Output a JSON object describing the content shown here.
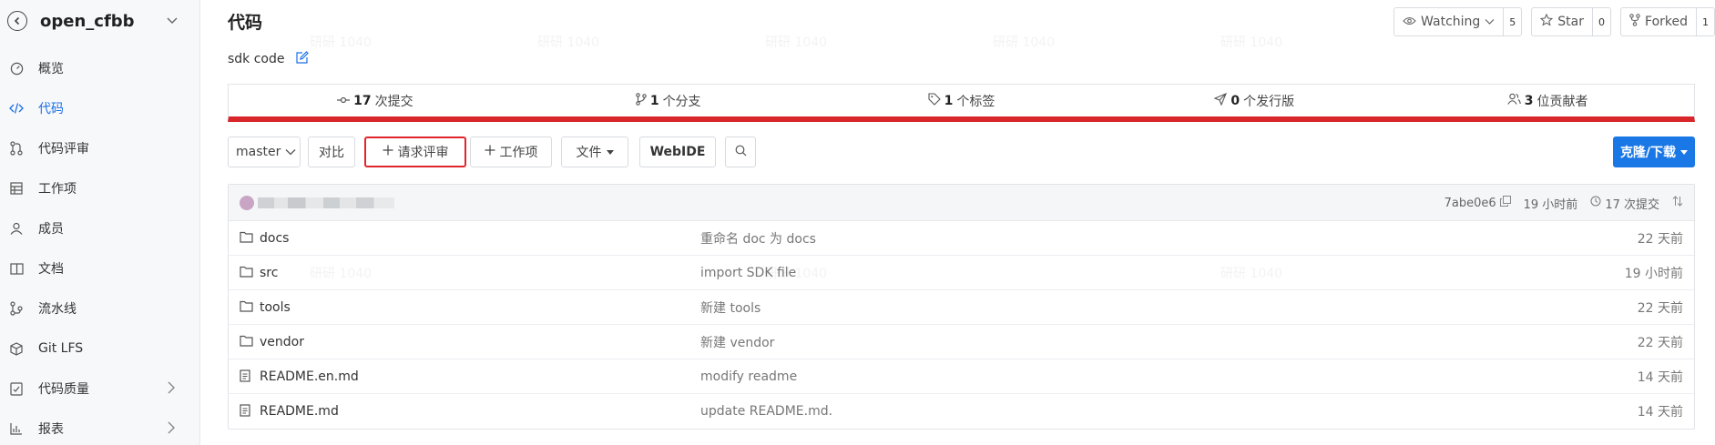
{
  "project": {
    "name": "open_cfbb"
  },
  "sidebar": {
    "items": [
      {
        "label": "概览",
        "icon": "gauge-icon"
      },
      {
        "label": "代码",
        "icon": "code-icon",
        "active": true
      },
      {
        "label": "代码评审",
        "icon": "merge-request-icon"
      },
      {
        "label": "工作项",
        "icon": "table-icon"
      },
      {
        "label": "成员",
        "icon": "user-icon"
      },
      {
        "label": "文档",
        "icon": "book-icon"
      },
      {
        "label": "流水线",
        "icon": "pipeline-icon"
      },
      {
        "label": "Git LFS",
        "icon": "cube-icon"
      },
      {
        "label": "代码质量",
        "icon": "shield-check-icon",
        "expandable": true
      },
      {
        "label": "报表",
        "icon": "bar-chart-icon",
        "expandable": true
      }
    ]
  },
  "header": {
    "title": "代码",
    "description": "sdk code",
    "watch_label": "Watching",
    "watch_count": "5",
    "star_label": "Star",
    "star_count": "0",
    "fork_label": "Forked",
    "fork_count": "1"
  },
  "stats": {
    "commits_num": "17",
    "commits_label": "次提交",
    "branches_num": "1",
    "branches_label": "个分支",
    "tags_num": "1",
    "tags_label": "个标签",
    "releases_num": "0",
    "releases_label": "个发行版",
    "contributors_num": "3",
    "contributors_label": "位贡献者",
    "accent_color": "#d8262b"
  },
  "toolbar": {
    "branch": "master",
    "compare": "对比",
    "merge_request": "请求评审",
    "work_item": "工作项",
    "file": "文件",
    "webide": "WebIDE",
    "clone": "克隆/下载"
  },
  "latest_commit": {
    "hash": "7abe0e6",
    "time": "19 小时前",
    "commit_count": "17 次提交"
  },
  "files": [
    {
      "type": "folder",
      "name": "docs",
      "message": "重命名 doc 为 docs",
      "time": "22 天前"
    },
    {
      "type": "folder",
      "name": "src",
      "message": "import SDK file",
      "time": "19 小时前"
    },
    {
      "type": "folder",
      "name": "tools",
      "message": "新建 tools",
      "time": "22 天前"
    },
    {
      "type": "folder",
      "name": "vendor",
      "message": "新建 vendor",
      "time": "22 天前"
    },
    {
      "type": "file",
      "name": "README.en.md",
      "message": "modify readme",
      "time": "14 天前"
    },
    {
      "type": "file",
      "name": "README.md",
      "message": "update README.md.",
      "time": "14 天前"
    }
  ]
}
